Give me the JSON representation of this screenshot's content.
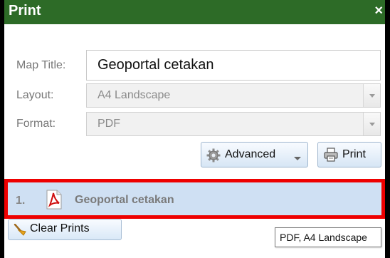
{
  "window": {
    "title": "Print",
    "close_label": "×"
  },
  "form": {
    "map_title_label": "Map Title:",
    "map_title_value": "Geoportal cetakan",
    "layout_label": "Layout:",
    "layout_value": "A4 Landscape",
    "format_label": "Format:",
    "format_value": "PDF"
  },
  "buttons": {
    "advanced_label": "Advanced",
    "print_label": "Print",
    "clear_prints_label": "Clear Prints"
  },
  "results": [
    {
      "index": "1.",
      "name": "Geoportal cetakan"
    }
  ],
  "tooltip": {
    "text": "PDF, A4 Landscape"
  },
  "icons": {
    "gear": "gear-icon",
    "chevron": "chevron-down-icon",
    "printer": "printer-icon",
    "pdf": "pdf-file-icon",
    "broom": "broom-icon",
    "close": "close-icon"
  },
  "colors": {
    "title_bar": "#2d6b27",
    "highlight": "#ee0000",
    "result_bg": "#cfe0f3"
  }
}
